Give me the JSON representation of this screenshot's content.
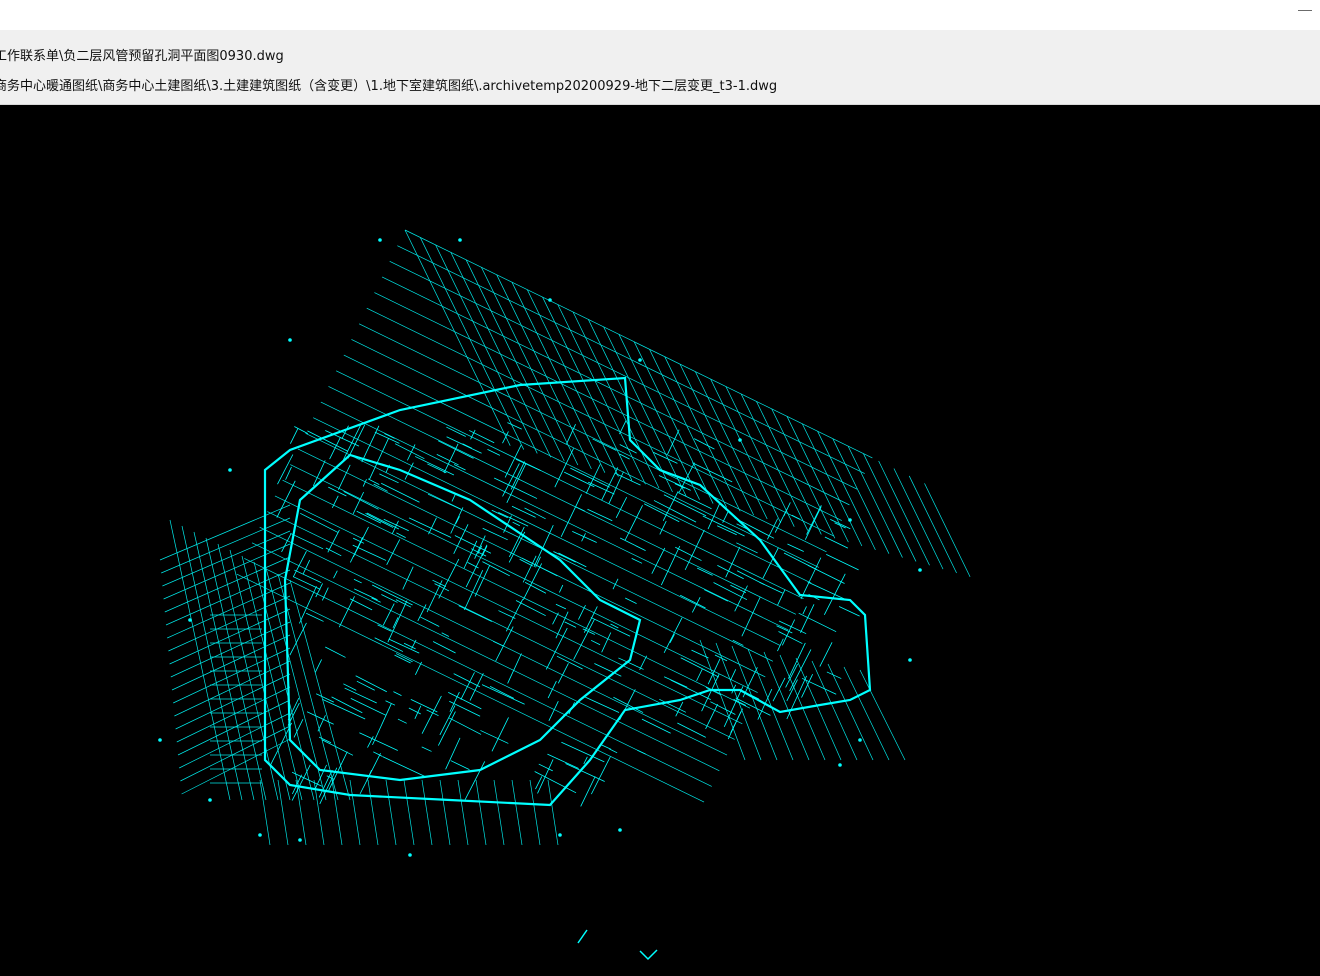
{
  "window": {
    "title": ""
  },
  "paths": {
    "line1": "工作联系单\\负二层风管预留孔洞平面图0930.dwg",
    "line2": "商务中心暖通图纸\\商务中心土建图纸\\3.土建建筑图纸（含变更）\\1.地下室建筑图纸\\.archivetemp20200929-地下二层变更_t3-1.dwg"
  },
  "drawing": {
    "background": "#000000",
    "line_color": "#00ffff"
  }
}
